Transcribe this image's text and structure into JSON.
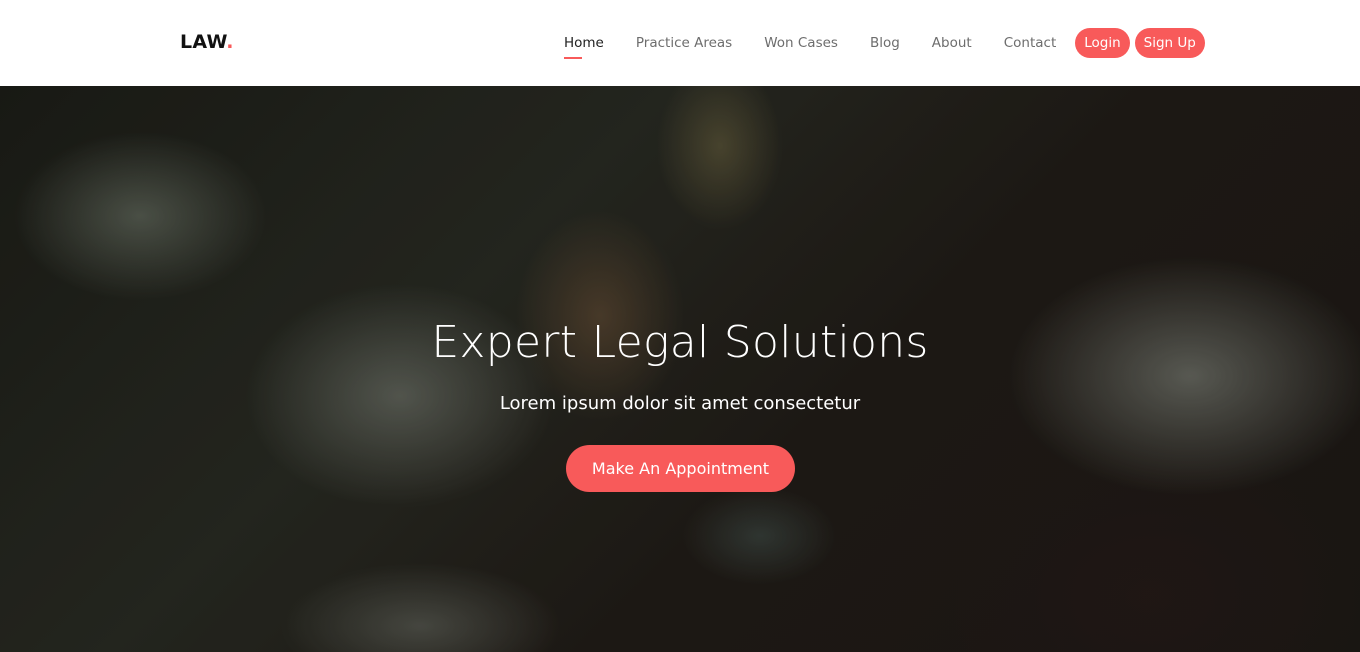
{
  "brand": {
    "name": "LAW",
    "dot": ".",
    "accent_color": "#f85a5a"
  },
  "nav": {
    "links": [
      {
        "label": "Home",
        "active": true
      },
      {
        "label": "Practice Areas",
        "active": false
      },
      {
        "label": "Won Cases",
        "active": false
      },
      {
        "label": "Blog",
        "active": false
      },
      {
        "label": "About",
        "active": false
      },
      {
        "label": "Contact",
        "active": false
      }
    ],
    "login_label": "Login",
    "signup_label": "Sign Up"
  },
  "hero": {
    "title": "Expert Legal Solutions",
    "subtitle": "Lorem ipsum dolor sit amet consectetur",
    "cta_label": "Make An Appointment",
    "background": "blurred-photo-hand-writing-magnifying-glass"
  }
}
